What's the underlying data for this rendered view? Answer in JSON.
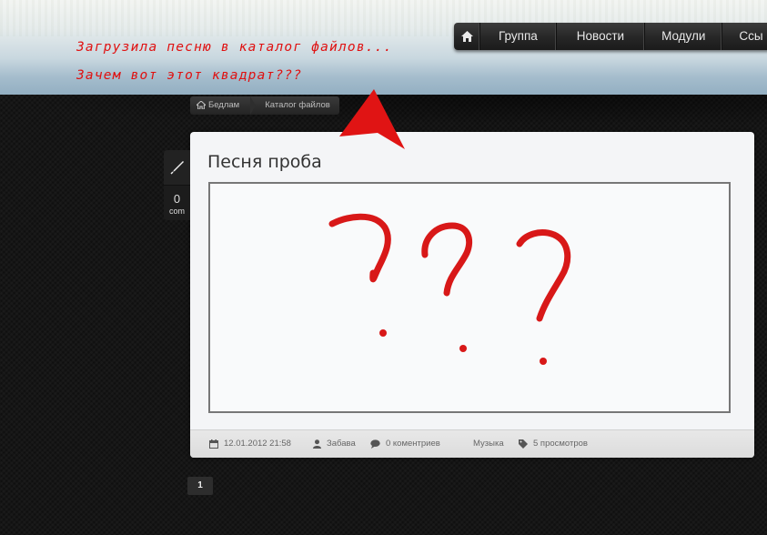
{
  "annotations": {
    "line1": "Загрузила песню в каталог файлов...",
    "line2": "Зачем вот этот квадрат???",
    "color": "#e01010"
  },
  "nav": {
    "items": [
      {
        "label": "Группа"
      },
      {
        "label": "Новости"
      },
      {
        "label": "Модули"
      },
      {
        "label": "Ссы"
      }
    ]
  },
  "breadcrumb": {
    "items": [
      {
        "label": "Бедлам"
      },
      {
        "label": "Каталог файлов"
      }
    ]
  },
  "side": {
    "comment_count": "0",
    "comment_label": "com"
  },
  "card": {
    "title": "Песня проба",
    "meta": {
      "date": "12.01.2012 21:58",
      "author": "Забава",
      "comments": "0 коментриев",
      "category": "Музыка",
      "views": "5 просмотров"
    }
  },
  "pager": {
    "current": "1"
  },
  "icons": {
    "nav_home": "home-icon",
    "crumb_home": "home-icon",
    "side_tool": "pen-icon",
    "date": "calendar-icon",
    "author": "user-icon",
    "comments": "speech-bubble-icon",
    "views": "tag-icon",
    "annotation_arrow": "red-arrow-icon"
  }
}
